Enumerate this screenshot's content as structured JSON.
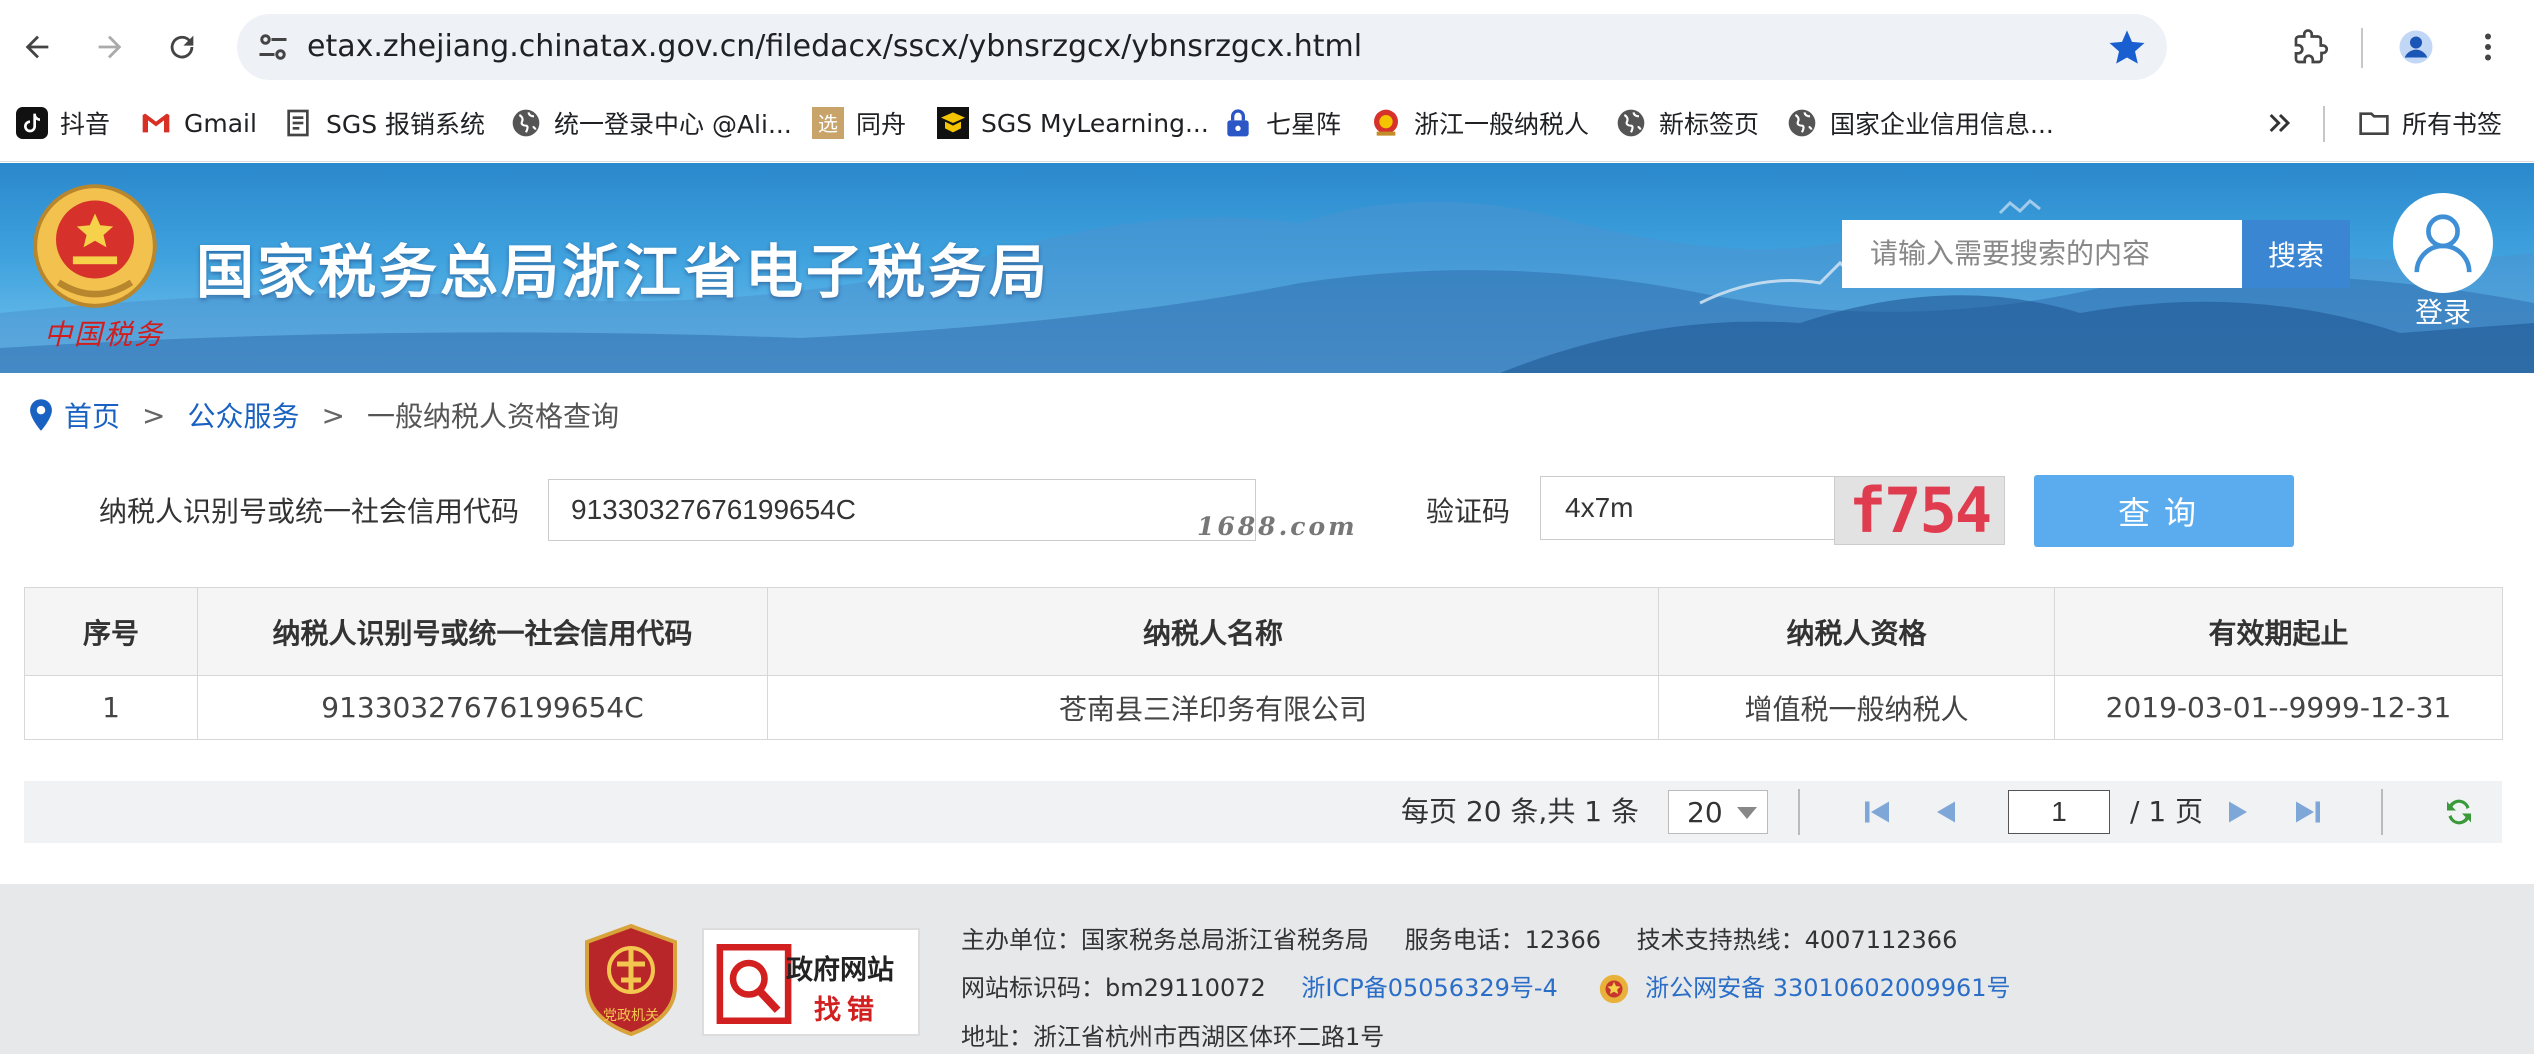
{
  "browser": {
    "url": "etax.zhejiang.chinatax.gov.cn/filedacx/sscx/ybnsrzgcx/ybnsrzgcx.html",
    "bookmarks": [
      {
        "label": "抖音",
        "icon": "douyin-icon"
      },
      {
        "label": "Gmail",
        "icon": "gmail-icon"
      },
      {
        "label": "SGS 报销系统",
        "icon": "document-icon"
      },
      {
        "label": "统一登录中心 @Ali...",
        "icon": "globe-icon"
      },
      {
        "label": "同舟",
        "icon": "tongzhou-icon"
      },
      {
        "label": "SGS MyLearning...",
        "icon": "mylearning-icon"
      },
      {
        "label": "七星阵",
        "icon": "lock-icon"
      },
      {
        "label": "浙江一般纳税人",
        "icon": "tax-emblem-icon"
      },
      {
        "label": "新标签页",
        "icon": "globe-icon"
      },
      {
        "label": "国家企业信用信息...",
        "icon": "globe-icon"
      }
    ],
    "all_bookmarks_label": "所有书签"
  },
  "header": {
    "site_title": "国家税务总局浙江省电子税务局",
    "emblem_caption": "中国税务",
    "search_placeholder": "请输入需要搜索的内容",
    "search_button": "搜索",
    "login_label": "登录"
  },
  "breadcrumb": {
    "home": "首页",
    "separator": ">",
    "public_service": "公众服务",
    "current": "一般纳税人资格查询"
  },
  "form": {
    "taxid_label": "纳税人识别号或统一社会信用代码",
    "taxid_value": "91330327676199654C",
    "watermark": "1688.com",
    "captcha_label": "验证码",
    "captcha_value": "4x7m",
    "captcha_image_text": "f754",
    "query_button": "查询"
  },
  "table": {
    "headers": [
      "序号",
      "纳税人识别号或统一社会信用代码",
      "纳税人名称",
      "纳税人资格",
      "有效期起止"
    ],
    "rows": [
      [
        "1",
        "91330327676199654C",
        "苍南县三洋印务有限公司",
        "增值税一般纳税人",
        "2019-03-01--9999-12-31"
      ]
    ]
  },
  "pagination": {
    "summary": "每页 20 条,共 1 条",
    "page_size": "20",
    "current_page": "1",
    "total_label": "/ 1 页"
  },
  "footer": {
    "organizer": "主办单位：国家税务总局浙江省税务局",
    "service_phone": "服务电话：12366",
    "support_hotline": "技术支持热线：4007112366",
    "site_code": "网站标识码：bm29110072",
    "icp": "浙ICP备05056329号-4",
    "police_record": "浙公网安备 33010602009961号",
    "address": "地址：浙江省杭州市西湖区体环二路1号",
    "party_badge_text": "党政机关",
    "gov_badge_line1": "政府网站",
    "gov_badge_line2": "找错"
  },
  "colors": {
    "banner": "#3fa2de",
    "link": "#1a62c2",
    "query_button": "#5aacee",
    "search_button": "#3a86d3",
    "captcha_text": "#e03c50"
  }
}
